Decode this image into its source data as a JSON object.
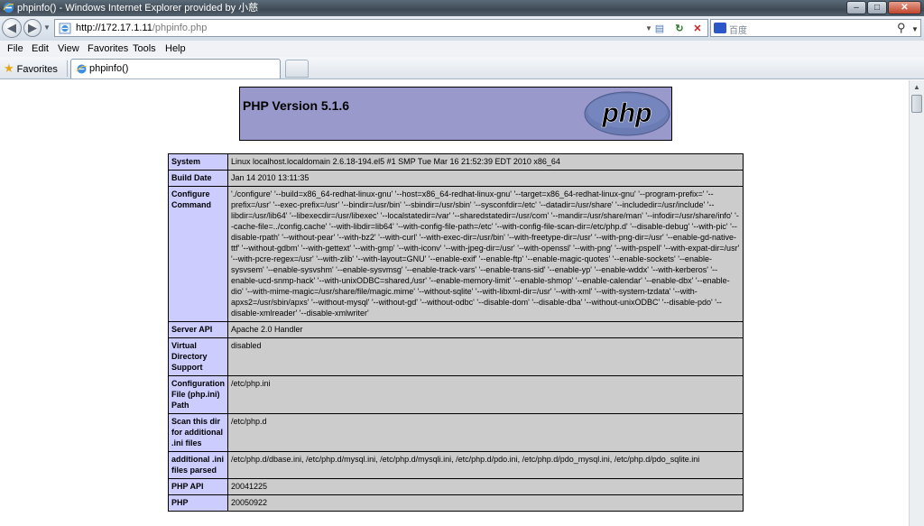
{
  "window": {
    "title": "phpinfo() - Windows Internet Explorer provided by 小慈",
    "controls": {
      "minimize": "–",
      "maximize": "□",
      "close": "✕"
    }
  },
  "address_bar": {
    "url_scheme_host": "http://172.17.1.11",
    "url_path": "/phpinfo.php",
    "search_placeholder": "百度"
  },
  "menu": [
    "File",
    "Edit",
    "View",
    "Favorites",
    "Tools",
    "Help"
  ],
  "favorites_bar": {
    "favorites_label": "Favorites",
    "tab_label": "phpinfo()"
  },
  "icons": {
    "back": "back-arrow-icon",
    "forward": "forward-arrow-icon",
    "refresh": "refresh-icon",
    "stop": "stop-icon",
    "search": "magnifier-icon",
    "favorites": "star-icon",
    "page": "ie-page-icon"
  },
  "colors": {
    "header_bg": "#9999cc",
    "label_bg": "#ccccff",
    "value_bg": "#cccccc"
  },
  "php": {
    "version_title": "PHP Version 5.1.6",
    "logo_text": "php",
    "rows": [
      {
        "label": "System",
        "value": "Linux localhost.localdomain 2.6.18-194.el5 #1 SMP Tue Mar 16 21:52:39 EDT 2010 x86_64"
      },
      {
        "label": "Build Date",
        "value": "Jan 14 2010 13:11:35"
      },
      {
        "label": "Configure Command",
        "value": "'./configure' '--build=x86_64-redhat-linux-gnu' '--host=x86_64-redhat-linux-gnu' '--target=x86_64-redhat-linux-gnu' '--program-prefix=' '--prefix=/usr' '--exec-prefix=/usr' '--bindir=/usr/bin' '--sbindir=/usr/sbin' '--sysconfdir=/etc' '--datadir=/usr/share' '--includedir=/usr/include' '--libdir=/usr/lib64' '--libexecdir=/usr/libexec' '--localstatedir=/var' '--sharedstatedir=/usr/com' '--mandir=/usr/share/man' '--infodir=/usr/share/info' '--cache-file=../config.cache' '--with-libdir=lib64' '--with-config-file-path=/etc' '--with-config-file-scan-dir=/etc/php.d' '--disable-debug' '--with-pic' '--disable-rpath' '--without-pear' '--with-bz2' '--with-curl' '--with-exec-dir=/usr/bin' '--with-freetype-dir=/usr' '--with-png-dir=/usr' '--enable-gd-native-ttf' '--without-gdbm' '--with-gettext' '--with-gmp' '--with-iconv' '--with-jpeg-dir=/usr' '--with-openssl' '--with-png' '--with-pspell' '--with-expat-dir=/usr' '--with-pcre-regex=/usr' '--with-zlib' '--with-layout=GNU' '--enable-exif' '--enable-ftp' '--enable-magic-quotes' '--enable-sockets' '--enable-sysvsem' '--enable-sysvshm' '--enable-sysvmsg' '--enable-track-vars' '--enable-trans-sid' '--enable-yp' '--enable-wddx' '--with-kerberos' '--enable-ucd-snmp-hack' '--with-unixODBC=shared,/usr' '--enable-memory-limit' '--enable-shmop' '--enable-calendar' '--enable-dbx' '--enable-dio' '--with-mime-magic=/usr/share/file/magic.mime' '--without-sqlite' '--with-libxml-dir=/usr' '--with-xml' '--with-system-tzdata' '--with-apxs2=/usr/sbin/apxs' '--without-mysql' '--without-gd' '--without-odbc' '--disable-dom' '--disable-dba' '--without-unixODBC' '--disable-pdo' '--disable-xmlreader' '--disable-xmlwriter'"
      },
      {
        "label": "Server API",
        "value": "Apache 2.0 Handler"
      },
      {
        "label": "Virtual Directory Support",
        "value": "disabled"
      },
      {
        "label": "Configuration File (php.ini) Path",
        "value": "/etc/php.ini"
      },
      {
        "label": "Scan this dir for additional .ini files",
        "value": "/etc/php.d"
      },
      {
        "label": "additional .ini files parsed",
        "value": "/etc/php.d/dbase.ini, /etc/php.d/mysql.ini, /etc/php.d/mysqli.ini, /etc/php.d/pdo.ini, /etc/php.d/pdo_mysql.ini, /etc/php.d/pdo_sqlite.ini"
      },
      {
        "label": "PHP API",
        "value": "20041225"
      },
      {
        "label": "PHP",
        "value": "20050922"
      }
    ]
  }
}
